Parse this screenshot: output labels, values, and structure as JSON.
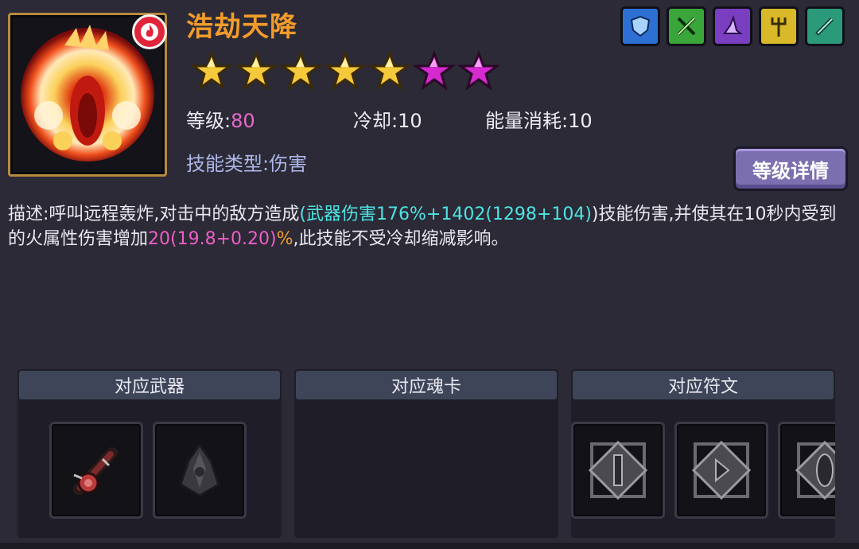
{
  "skill": {
    "title": "浩劫天降",
    "stars_total": 7,
    "stars_gold": 5,
    "stars_purple": 2,
    "level_label": "等级:",
    "level_value": "80",
    "cooldown_label": "冷却:",
    "cooldown_value": "10",
    "energy_label": "能量消耗:",
    "energy_value": "10",
    "type_label": "技能类型:",
    "type_value": "伤害",
    "detail_button": "等级详情",
    "icon": "meteor-fire-icon",
    "badge_icon": "fire-element-icon"
  },
  "description": {
    "part1": "描述:呼叫远程轰炸,对击中的敌方造成",
    "part2": "(武器伤害176%+1402(1298+104)",
    "part3": ")技能伤害,并使其在10秒内受到的火属性伤害增加",
    "part4": "20(19.8+0.20)",
    "part5": "%",
    "part6": ",此技能不受冷却缩减影响。"
  },
  "class_icons": [
    {
      "name": "shield-class-icon",
      "color": "#2e6fd4"
    },
    {
      "name": "crossed-swords-class-icon",
      "color": "#3aa53a"
    },
    {
      "name": "wizard-hat-class-icon",
      "color": "#7a3fc0"
    },
    {
      "name": "trident-class-icon",
      "color": "#d9b92a"
    },
    {
      "name": "sword-class-icon",
      "color": "#2a9a7a"
    }
  ],
  "panels": {
    "weapons_title": "对应武器",
    "soul_cards_title": "对应魂卡",
    "runes_title": "对应符文"
  },
  "colors": {
    "title_orange": "#f39c2c",
    "value_pink": "#e86ac8",
    "cyan": "#4de4e4",
    "button_purple": "#7c6fb0"
  }
}
